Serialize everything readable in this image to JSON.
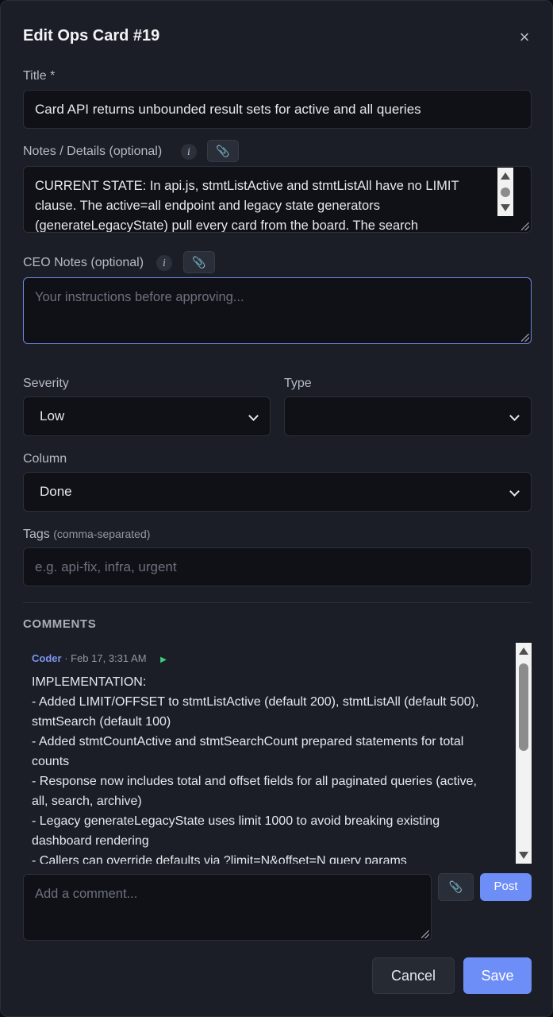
{
  "dialog": {
    "title": "Edit Ops Card #19",
    "close_icon": "×"
  },
  "fields": {
    "title_label": "Title *",
    "title_value": "Card API returns unbounded result sets for active and all queries",
    "notes_label": "Notes / Details (optional)",
    "notes_lines": [
      "CURRENT STATE: In api.js, stmtListActive and stmtListAll have no LIMIT",
      "clause. The active=all endpoint and legacy state generators",
      "(generateLegacyState) pull every card from the board. The search"
    ],
    "ceo_label": "CEO Notes (optional)",
    "ceo_placeholder": "Your instructions before approving...",
    "severity_label": "Severity",
    "severity_value": "Low",
    "type_label": "Type",
    "type_value": "",
    "column_label": "Column",
    "column_value": "Done",
    "tags_label": "Tags",
    "tags_hint": "(comma-separated)",
    "tags_placeholder": "e.g. api-fix, infra, urgent"
  },
  "icons": {
    "info": "i",
    "paperclip": "📎"
  },
  "comments": {
    "section_title": "COMMENTS",
    "items": [
      {
        "author": "Coder",
        "timestamp": "· Feb 17, 3:31 AM",
        "play": "▶",
        "lines": [
          "IMPLEMENTATION:",
          "- Added LIMIT/OFFSET to stmtListActive (default 200), stmtListAll (default 500),",
          "stmtSearch (default 100)",
          "- Added stmtCountActive and stmtSearchCount prepared statements for total",
          "counts",
          "- Response now includes total and offset fields for all paginated queries (active,",
          "all, search, archive)",
          "- Legacy generateLegacyState uses limit 1000 to avoid breaking existing",
          "dashboard rendering",
          "- Callers can override defaults via ?limit=N&offset=N query params"
        ]
      }
    ],
    "add_placeholder": "Add a comment...",
    "post_label": "Post"
  },
  "footer": {
    "cancel_label": "Cancel",
    "save_label": "Save"
  },
  "colors": {
    "accent": "#6e8ef7",
    "background": "#1b1e26",
    "input_bg": "#101117",
    "author": "#7c95f0"
  }
}
